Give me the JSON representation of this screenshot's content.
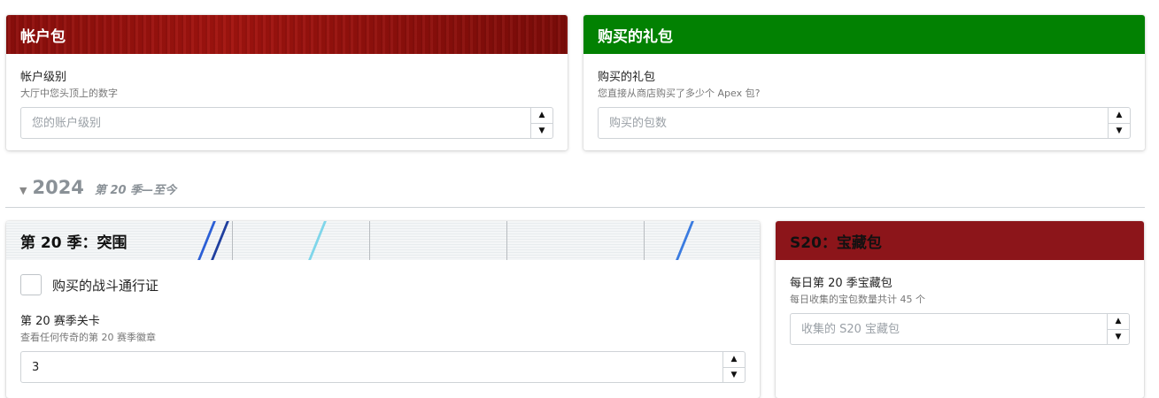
{
  "account_pack": {
    "header": "帐户包",
    "level_label": "帐户级别",
    "level_help": "大厅中您头顶上的数字",
    "level_placeholder": "您的账户级别",
    "level_value": ""
  },
  "purchased_packs": {
    "header": "购买的礼包",
    "label": "购买的礼包",
    "help": "您直接从商店购买了多少个 Apex 包?",
    "placeholder": "购买的包数",
    "value": ""
  },
  "section": {
    "year": "2024",
    "subtitle": "第 20 季—至今"
  },
  "season20": {
    "header": "第 20 季：突围",
    "battlepass_label": "购买的战斗通行证",
    "battlepass_checked": false,
    "level_label": "第 20 赛季关卡",
    "level_help": "查看任何传奇的第 20 赛季徽章",
    "level_value": "3"
  },
  "treasure_packs": {
    "header": "S20：宝藏包",
    "label": "每日第 20 季宝藏包",
    "help": "每日收集的宝包数量共计 45 个",
    "placeholder": "收集的 S20 宝藏包",
    "value": ""
  },
  "icons": {
    "spinner_up": "▲",
    "spinner_down": "▼",
    "section_caret": "▼"
  },
  "colors": {
    "green_header": "#028102",
    "darkred_header": "#8c151a",
    "wood_header": "#9a120e",
    "muted_text": "#8a9197"
  }
}
